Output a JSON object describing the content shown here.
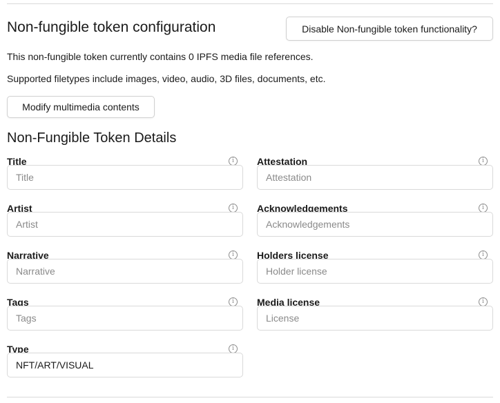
{
  "config": {
    "title": "Non-fungible token configuration",
    "disable_button_label": "Disable Non-fungible token functionality?",
    "info_ipfs": "This non-fungible token currently contains 0 IPFS media file references.",
    "info_filetypes": "Supported filetypes include images, video, audio, 3D files, documents, etc.",
    "modify_button_label": "Modify multimedia contents"
  },
  "details": {
    "title": "Non-Fungible Token Details",
    "help_icon_glyph": "i",
    "fields": [
      {
        "label": "Title",
        "placeholder": "Title",
        "value": ""
      },
      {
        "label": "Attestation",
        "placeholder": "Attestation",
        "value": ""
      },
      {
        "label": "Artist",
        "placeholder": "Artist",
        "value": ""
      },
      {
        "label": "Acknowledgements",
        "placeholder": "Acknowledgements",
        "value": ""
      },
      {
        "label": "Narrative",
        "placeholder": "Narrative",
        "value": ""
      },
      {
        "label": "Holders license",
        "placeholder": "Holder license",
        "value": ""
      },
      {
        "label": "Tags",
        "placeholder": "Tags",
        "value": ""
      },
      {
        "label": "Media license",
        "placeholder": "License",
        "value": ""
      },
      {
        "label": "Type",
        "placeholder": "",
        "value": "NFT/ART/VISUAL"
      }
    ]
  }
}
